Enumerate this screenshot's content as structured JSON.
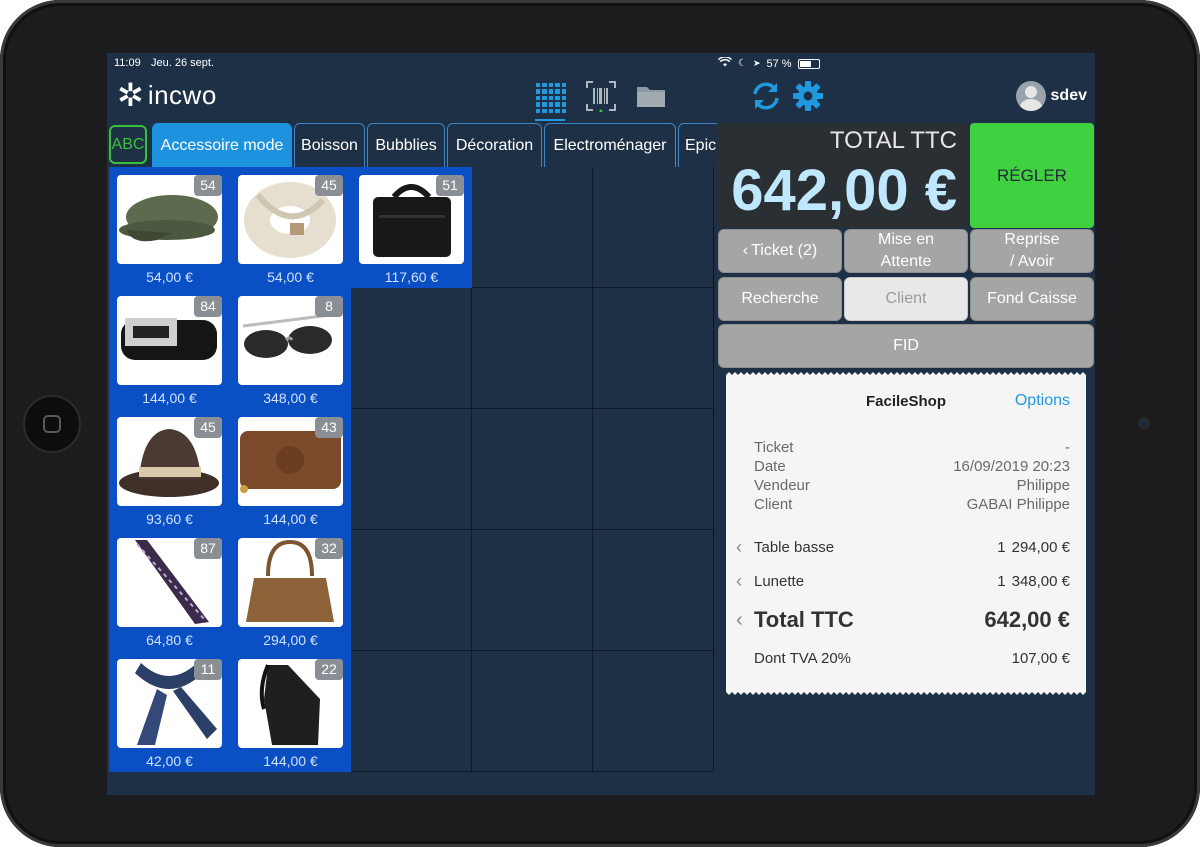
{
  "status": {
    "time": "11:09",
    "date": "Jeu. 26 sept.",
    "battery": "57 %"
  },
  "app": {
    "logo_mark": "✲",
    "logo_text": "incwo"
  },
  "toolbar_icons": [
    "grid-icon",
    "barcode-icon",
    "folder-icon",
    "sync-icon",
    "gear-icon"
  ],
  "user": {
    "name": "sdev"
  },
  "tabs": [
    {
      "label": "ABC"
    },
    {
      "label": "Accessoire mode"
    },
    {
      "label": "Boisson"
    },
    {
      "label": "Bubblies"
    },
    {
      "label": "Décoration"
    },
    {
      "label": "Electroménager"
    },
    {
      "label": "Epic"
    }
  ],
  "products": [
    {
      "name": "cap",
      "qty": "54",
      "price": "54,00 €"
    },
    {
      "name": "scarf-knit",
      "qty": "45",
      "price": "54,00 €"
    },
    {
      "name": "bag",
      "qty": "51",
      "price": "117,60 €"
    },
    {
      "name": "belt",
      "qty": "84",
      "price": "144,00 €"
    },
    {
      "name": "sunglasses",
      "qty": "8",
      "price": "348,00 €"
    },
    {
      "name": "hat",
      "qty": "45",
      "price": "93,60 €"
    },
    {
      "name": "wallet",
      "qty": "43",
      "price": "144,00 €"
    },
    {
      "name": "tie",
      "qty": "87",
      "price": "64,80 €"
    },
    {
      "name": "handbag",
      "qty": "32",
      "price": "294,00 €"
    },
    {
      "name": "scarf",
      "qty": "11",
      "price": "42,00 €"
    },
    {
      "name": "backpack",
      "qty": "22",
      "price": "144,00 €"
    }
  ],
  "total": {
    "label": "TOTAL TTC",
    "amount": "642,00 €"
  },
  "buttons": {
    "regler": "RÉGLER",
    "ticket": "Ticket (2)",
    "mise_en_attente_1": "Mise en",
    "mise_en_attente_2": "Attente",
    "reprise_1": "Reprise",
    "reprise_2": "/ Avoir",
    "recherche": "Recherche",
    "client": "Client",
    "fond_caisse": "Fond Caisse",
    "fid": "FID"
  },
  "receipt": {
    "shop": "FacileShop",
    "options": "Options",
    "info": [
      {
        "label": "Ticket",
        "value": "-"
      },
      {
        "label": "Date",
        "value": "16/09/2019 20:23"
      },
      {
        "label": "Vendeur",
        "value": "Philippe"
      },
      {
        "label": "Client",
        "value": "GABAI Philippe"
      }
    ],
    "lines": [
      {
        "name": "Table basse",
        "qty": "1",
        "price": "294,00 €"
      },
      {
        "name": "Lunette",
        "qty": "1",
        "price": "348,00 €"
      }
    ],
    "total_label": "Total TTC",
    "total_value": "642,00 €",
    "tva_label": "Dont TVA 20%",
    "tva_value": "107,00 €"
  }
}
